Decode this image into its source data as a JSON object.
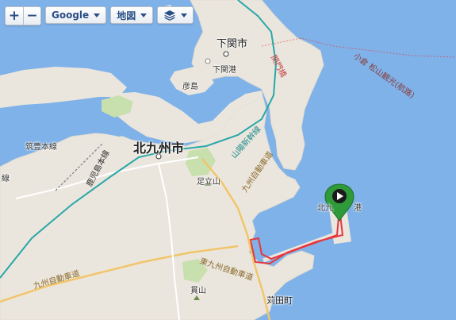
{
  "toolbar": {
    "zoom_in": "+",
    "zoom_out": "−",
    "provider_label": "Google",
    "maptype_label": "地図"
  },
  "labels": {
    "kitakyushu": "北九州市",
    "shimonoseki": "下関市",
    "shimonoseki_port": "下関港",
    "hikoshima": "彦島",
    "kanmon_bridge": "関門橋",
    "ferry_route": "小倉 松山観光(航路)",
    "sanyo_shinkansen": "山陽新幹線",
    "kyushu_expressway_north": "九州自動車道",
    "chikuho_line": "筑豊本線",
    "kagoshima_line": "鹿児島本線",
    "line_left": "線",
    "adachiyama": "足立山",
    "higashi_kyushu_expressway": "東九州自動車道",
    "kyushu_expressway": "九州自動車道",
    "nukiyama": "貫山",
    "kanda_town": "苅田町",
    "port_left": "北九",
    "port_right": "港"
  },
  "colors": {
    "sea": "#7fb2e8",
    "land": "#ebe6dd",
    "park": "#c8dfae",
    "route": "#e8363e",
    "marker": "#2f9a3a",
    "rail": "#2aa7a8"
  },
  "icons": {
    "layers": "layers-icon",
    "marker": "play-marker-icon"
  }
}
